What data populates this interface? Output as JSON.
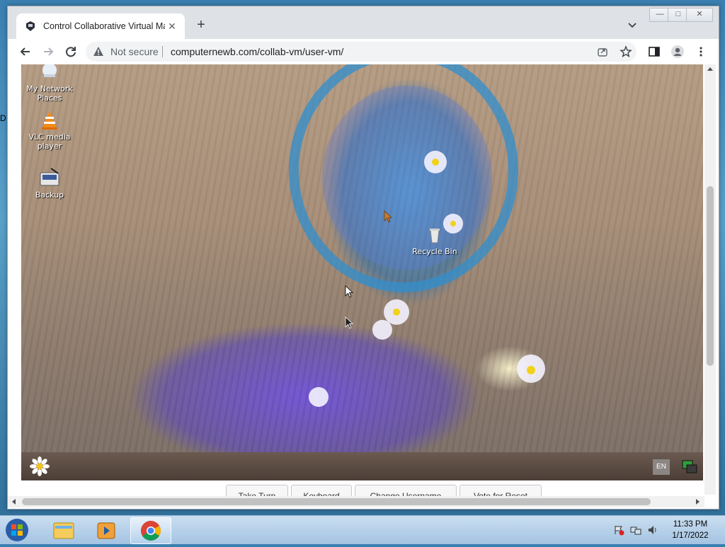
{
  "browser": {
    "tab_title": "Control Collaborative Virtual Ma",
    "new_tab_label": "+",
    "security_label": "Not secure",
    "url": "computernewb.com/collab-vm/user-vm/",
    "window_controls": {
      "minimize": "—",
      "maximize": "□",
      "close": "✕"
    }
  },
  "vm": {
    "desktop_icons": [
      {
        "label": "My Network Places",
        "icon": "network-icon"
      },
      {
        "label": "VLC media player",
        "icon": "vlc-icon"
      },
      {
        "label": "Backup",
        "icon": "backup-icon"
      },
      {
        "label": "Recycle Bin",
        "icon": "recycle-bin-icon"
      }
    ],
    "taskbar": {
      "lang": "EN",
      "start_icon": "daisy-start-icon",
      "tray_icon": "network-tray-icon"
    }
  },
  "page_buttons": [
    "Take Turn",
    "Keyboard",
    "Change Username",
    "Vote for Reset"
  ],
  "host_taskbar": {
    "apps": [
      "explorer-icon",
      "media-player-icon",
      "chrome-icon"
    ],
    "time": "11:33 PM",
    "date": "1/17/2022"
  },
  "colors": {
    "accent": "#1a73e8",
    "vm_taskbar": "#5a4a42"
  }
}
